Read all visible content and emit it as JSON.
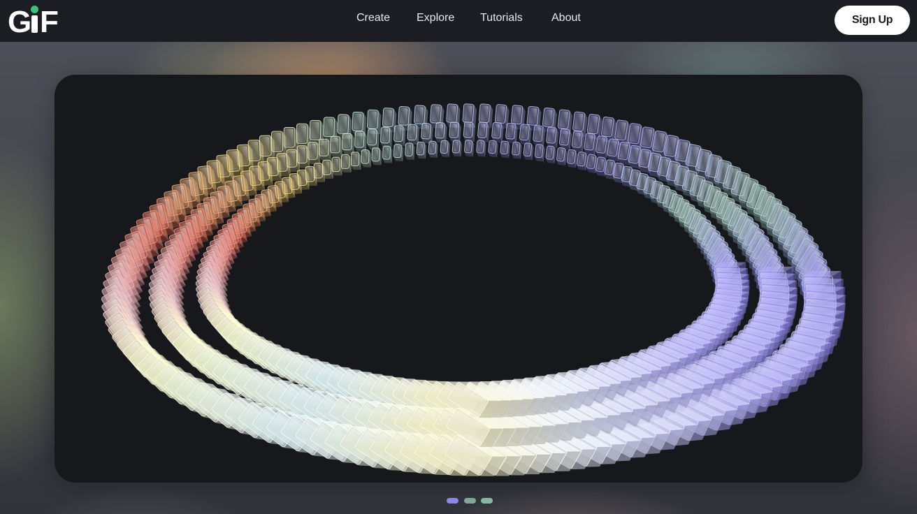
{
  "brand": {
    "logo_text": "GiF",
    "logo_color": "#ffffff",
    "logo_dot_color": "#3fbf7a"
  },
  "nav": {
    "links": [
      "Create",
      "Explore",
      "Tutorials",
      "About"
    ],
    "signup_label": "Sign Up"
  },
  "hero": {
    "image": "rotating-ring-of-translucent-glass-cubes"
  },
  "carousel": {
    "dot_colors": [
      "#8b87e6",
      "#7fa898",
      "#86b8a4"
    ],
    "active_index": 0
  }
}
